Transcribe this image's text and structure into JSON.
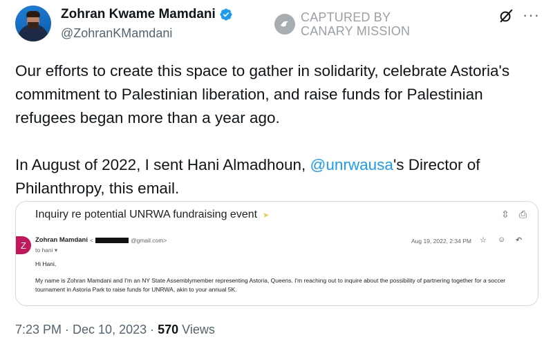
{
  "author": {
    "name": "Zohran Kwame Mamdani",
    "handle": "@ZohranKMamdani"
  },
  "watermark": {
    "line1": "CAPTURED BY",
    "line2": "CANARY MISSION"
  },
  "tweet": {
    "paragraph1": "Our efforts to create this space to gather in solidarity, celebrate Astoria's commitment to Palestinian liberation, and raise funds for Palestinian refugees began more than a year ago.",
    "paragraph2_before": "In August of 2022, I sent Hani Almadhoun, ",
    "paragraph2_mention": "@unrwausa",
    "paragraph2_after": "'s Director of Philanthropy, this email."
  },
  "email": {
    "subject": "Inquiry re potential UNRWA fundraising event",
    "sender_initial": "Z",
    "sender_name": "Zohran Mamdani",
    "sender_email_prefix": "<",
    "sender_email_domain": "@gmail.com>",
    "to": "to hani ▾",
    "date": "Aug 19, 2022, 2:34 PM",
    "greeting": "Hi Hani,",
    "body": "My name is Zohran Mamdani and I'm an NY State Assemblymember representing Astoria, Queens. I'm reaching out to inquire about the possibility of partnering together for a soccer tournament in Astoria Park to raise funds for UNRWA, akin to your annual 5K."
  },
  "meta": {
    "time": "7:23 PM · Dec 10, 2023 · ",
    "views_count": "570",
    "views_label": " Views"
  },
  "colors": {
    "accent": "#1d9bf0",
    "text": "#0f1419",
    "secondary": "#536471",
    "sender_avatar": "#c2185b"
  },
  "icons": [
    "verified-badge-icon",
    "canary-mission-logo-icon",
    "grok-icon",
    "more-icon",
    "expand-icon",
    "print-icon",
    "star-icon",
    "emoji-icon",
    "reply-icon",
    "important-marker-icon"
  ]
}
